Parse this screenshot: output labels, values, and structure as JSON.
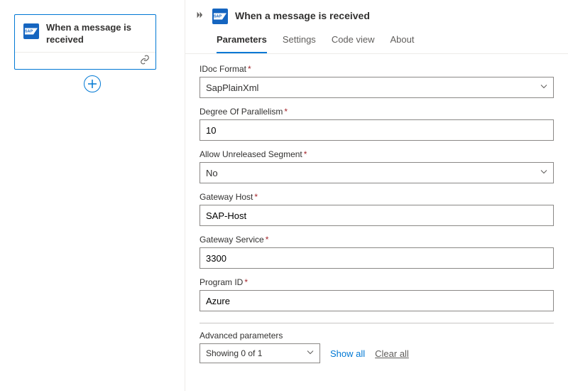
{
  "canvas": {
    "trigger_title": "When a message is received"
  },
  "panel": {
    "title": "When a message is received",
    "tabs": [
      {
        "label": "Parameters",
        "active": true
      },
      {
        "label": "Settings",
        "active": false
      },
      {
        "label": "Code view",
        "active": false
      },
      {
        "label": "About",
        "active": false
      }
    ]
  },
  "fields": {
    "idoc_format": {
      "label": "IDoc Format",
      "value": "SapPlainXml",
      "required": true,
      "type": "select"
    },
    "degree_of_parallelism": {
      "label": "Degree Of Parallelism",
      "value": "10",
      "required": true,
      "type": "text"
    },
    "allow_unreleased_segment": {
      "label": "Allow Unreleased Segment",
      "value": "No",
      "required": true,
      "type": "select"
    },
    "gateway_host": {
      "label": "Gateway Host",
      "value": "SAP-Host",
      "required": true,
      "type": "text"
    },
    "gateway_service": {
      "label": "Gateway Service",
      "value": "3300",
      "required": true,
      "type": "text"
    },
    "program_id": {
      "label": "Program ID",
      "value": "Azure",
      "required": true,
      "type": "text"
    }
  },
  "advanced": {
    "heading": "Advanced parameters",
    "showing": "Showing 0 of 1",
    "show_all": "Show all",
    "clear_all": "Clear all"
  }
}
